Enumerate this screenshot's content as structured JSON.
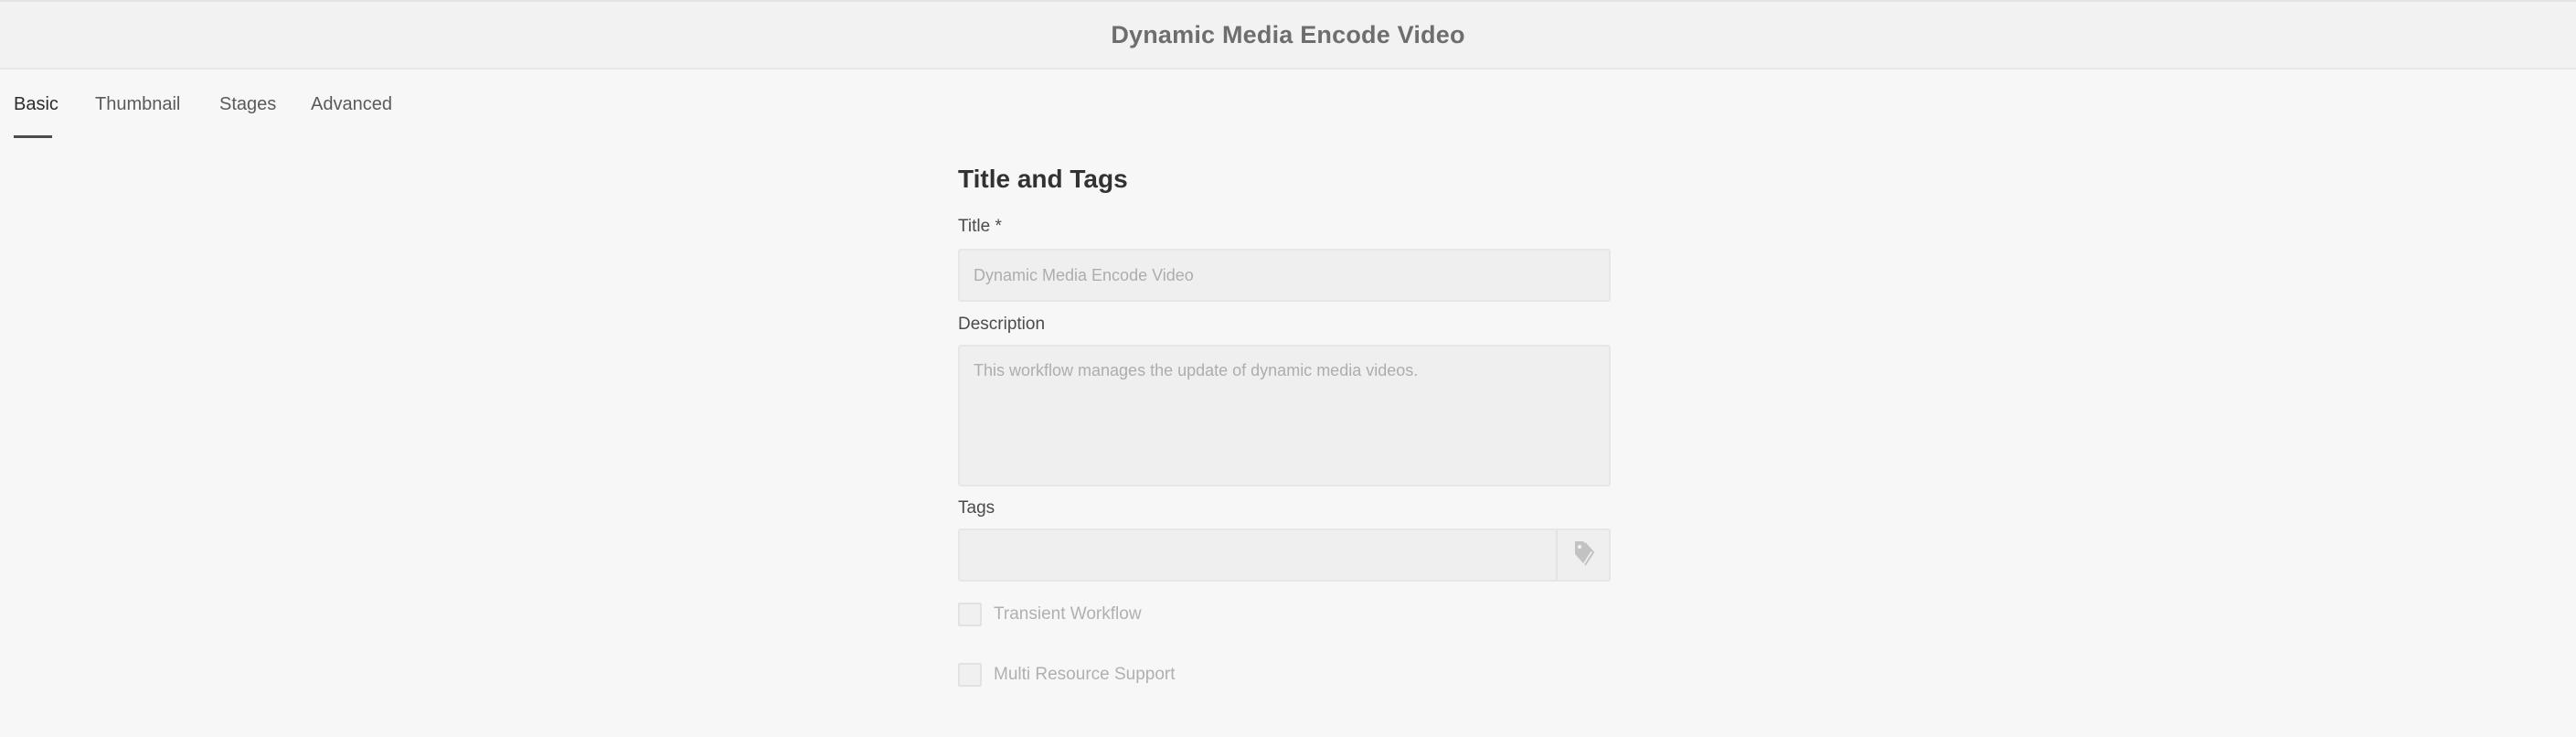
{
  "header": {
    "title": "Dynamic Media Encode Video"
  },
  "tabs": [
    {
      "label": "Basic",
      "active": true
    },
    {
      "label": "Thumbnail",
      "active": false
    },
    {
      "label": "Stages",
      "active": false
    },
    {
      "label": "Advanced",
      "active": false
    }
  ],
  "form": {
    "section_title": "Title and Tags",
    "title_label": "Title *",
    "title_placeholder": "Dynamic Media Encode Video",
    "description_label": "Description",
    "description_placeholder": "This workflow manages the update of dynamic media videos.",
    "tags_label": "Tags",
    "tags_icon": "tag-icon",
    "transient_label": "Transient Workflow",
    "transient_checked": false,
    "multi_resource_label": "Multi Resource Support",
    "multi_resource_checked": false
  },
  "colors": {
    "background": "#f7f7f7",
    "header_background": "#f2f2f2",
    "field_background": "#efefef",
    "active_tab_underline": "#4b4b4b"
  }
}
